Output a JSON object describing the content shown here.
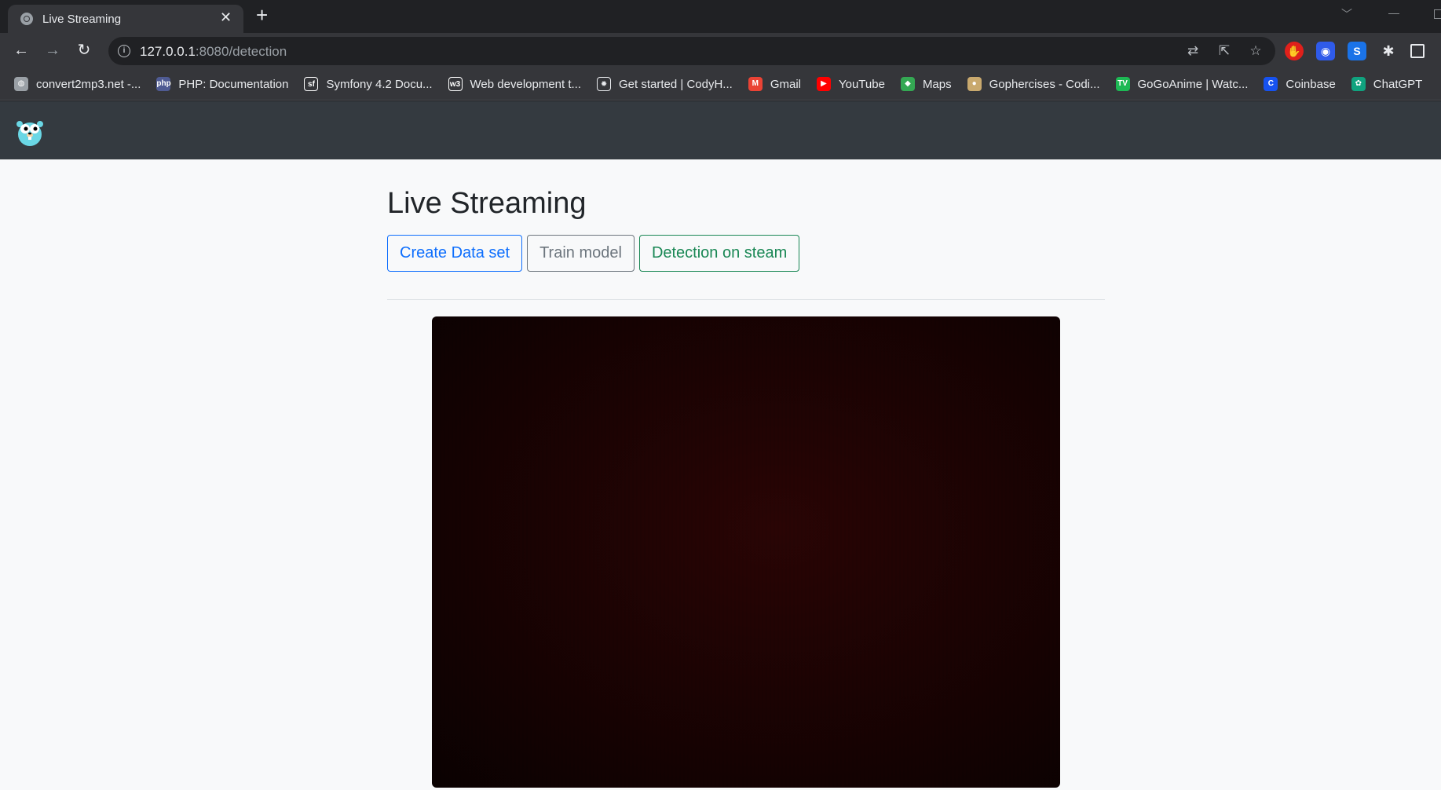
{
  "browser": {
    "tab": {
      "title": "Live Streaming",
      "close": "✕"
    },
    "new_tab": "+",
    "address": {
      "host": "127.0.0.1",
      "rest": ":8080/detection"
    },
    "bookmarks": [
      {
        "label": "convert2mp3.net -...",
        "icon": "globe-icon",
        "color": "#9aa0a6"
      },
      {
        "label": "PHP: Documentation",
        "icon": "php-icon",
        "color": "#4f5b93"
      },
      {
        "label": "Symfony 4.2 Docu...",
        "icon": "symfony-icon",
        "color": "#ffffff"
      },
      {
        "label": "Web development t...",
        "icon": "w3schools-icon",
        "color": "#ffffff"
      },
      {
        "label": "Get started | CodyH...",
        "icon": "bug-icon",
        "color": "#e8eaed"
      },
      {
        "label": "Gmail",
        "icon": "gmail-icon",
        "color": "#ea4335"
      },
      {
        "label": "YouTube",
        "icon": "youtube-icon",
        "color": "#ff0000"
      },
      {
        "label": "Maps",
        "icon": "maps-icon",
        "color": "#34a853"
      },
      {
        "label": "Gophercises - Codi...",
        "icon": "gopher-icon",
        "color": "#c9a96e"
      },
      {
        "label": "GoGoAnime | Watc...",
        "icon": "tv-icon",
        "color": "#1db954"
      },
      {
        "label": "Coinbase",
        "icon": "coinbase-icon",
        "color": "#1652f0"
      },
      {
        "label": "ChatGPT",
        "icon": "chatgpt-icon",
        "color": "#10a37f"
      }
    ]
  },
  "app": {
    "title": "Live Streaming",
    "buttons": {
      "create": "Create Data set",
      "train": "Train model",
      "detect": "Detection on steam"
    }
  }
}
